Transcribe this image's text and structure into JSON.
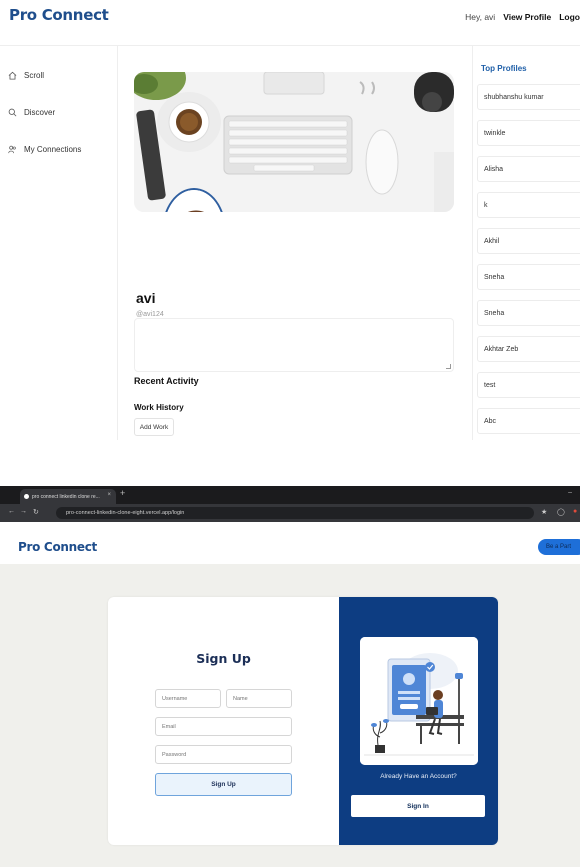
{
  "profile_screen": {
    "brand": "Pro Connect",
    "topnav": {
      "greeting": "Hey, avi",
      "view_profile": "View Profile",
      "logout": "Logo"
    },
    "sidebar": {
      "items": [
        {
          "label": "Scroll",
          "icon": "home-icon"
        },
        {
          "label": "Discover",
          "icon": "search-icon"
        },
        {
          "label": "My Connections",
          "icon": "people-icon"
        }
      ]
    },
    "profile": {
      "name": "avi",
      "handle": "@avi124"
    },
    "sections": {
      "recent_activity": "Recent Activity",
      "work_history": "Work History",
      "add_work": "Add Work"
    },
    "top_profiles": {
      "title": "Top Profiles",
      "items": [
        "shubhanshu kumar",
        "twinkle",
        "Alisha",
        "k",
        "Akhil",
        "Sneha",
        "Sneha",
        "Akhtar Zeb",
        "test",
        "Abc"
      ]
    }
  },
  "signup_screen": {
    "browser": {
      "tab_title": "pro connect linkedin clone re...",
      "url": "pro-connect-linkedin-clone-eight.vercel.app/login"
    },
    "brand": "Pro Connect",
    "join_button": "Be a Part",
    "heading": "Sign Up",
    "fields": {
      "username": "Username",
      "name": "Name",
      "email": "Email",
      "password": "Password"
    },
    "signup_button": "Sign Up",
    "already": "Already Have an Account?",
    "signin_button": "Sign In"
  },
  "colors": {
    "brand": "#1f4e8c",
    "panel": "#0d3d82",
    "accent": "#1e6fd8"
  }
}
